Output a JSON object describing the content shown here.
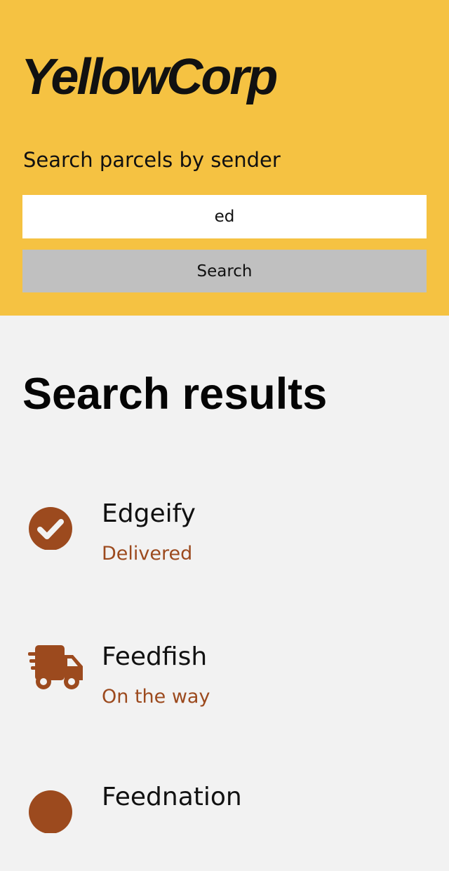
{
  "header": {
    "logo_text": "YellowCorp",
    "search_label": "Search parcels by sender",
    "search_value": "ed",
    "search_button_label": "Search"
  },
  "results": {
    "title": "Search results",
    "items": [
      {
        "sender": "Edgeify",
        "status": "Delivered",
        "icon": "check-circle-icon"
      },
      {
        "sender": "Feedfish",
        "status": "On the way",
        "icon": "delivery-truck-icon"
      },
      {
        "sender": "Feednation",
        "status": "",
        "icon": "status-icon"
      }
    ]
  },
  "colors": {
    "header_bg": "#f5c242",
    "page_bg": "#f2f2f2",
    "accent": "#9c4a1e",
    "button_bg": "#c0c0c0"
  }
}
